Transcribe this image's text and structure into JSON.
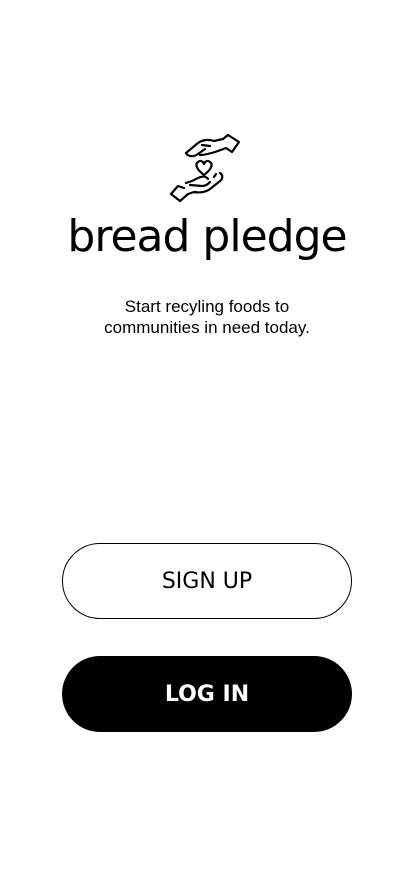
{
  "app": {
    "name": "bread pledge",
    "logo_icon": "hands-heart-icon",
    "tagline_line1": "Start recyling foods to",
    "tagline_line2": "communities in need today."
  },
  "actions": {
    "signup_label": "SIGN UP",
    "login_label": "LOG IN"
  },
  "colors": {
    "background": "#ffffff",
    "text": "#000000",
    "primary_button": "#000000",
    "primary_button_text": "#ffffff"
  }
}
